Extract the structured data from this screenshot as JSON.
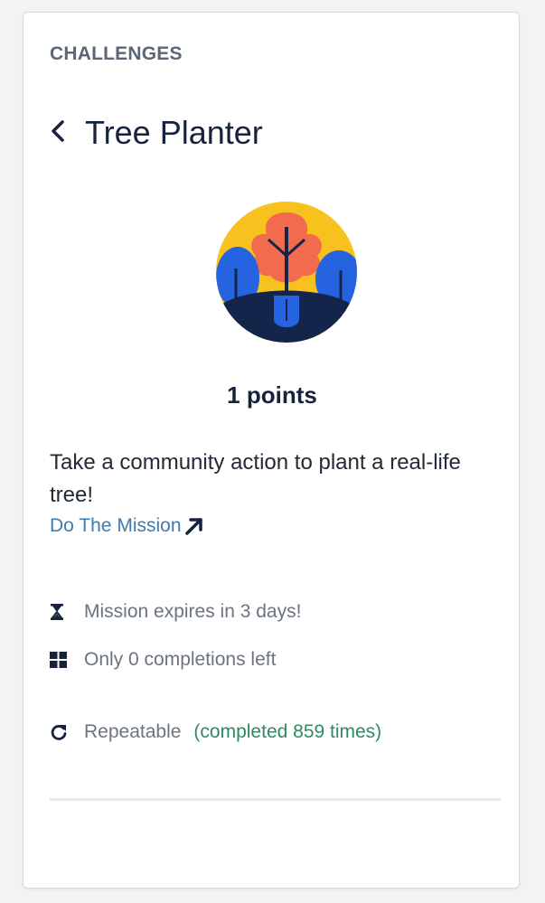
{
  "header": {
    "title": "CHALLENGES"
  },
  "challenge": {
    "title": "Tree Planter",
    "points": "1 points",
    "description": "Take a community action to plant a real-life tree!",
    "mission_link": "Do The Mission",
    "expires": "Mission expires in 3 days!",
    "completions_left": "Only 0 completions left",
    "repeatable": "Repeatable",
    "completed_count": "(completed 859 times)"
  },
  "icons": {
    "back": "chevron-left-icon",
    "external": "arrow-up-right-icon",
    "expires": "hourglass-icon",
    "completions": "grid-icon",
    "repeat": "refresh-icon"
  },
  "colors": {
    "title": "#17233d",
    "link": "#3e7bb0",
    "completed": "#2d8a61",
    "muted": "#6c7480",
    "badge_yellow": "#f7c21e",
    "badge_orange": "#f26b4e",
    "badge_blue": "#2563e0",
    "badge_navy": "#13254a"
  }
}
